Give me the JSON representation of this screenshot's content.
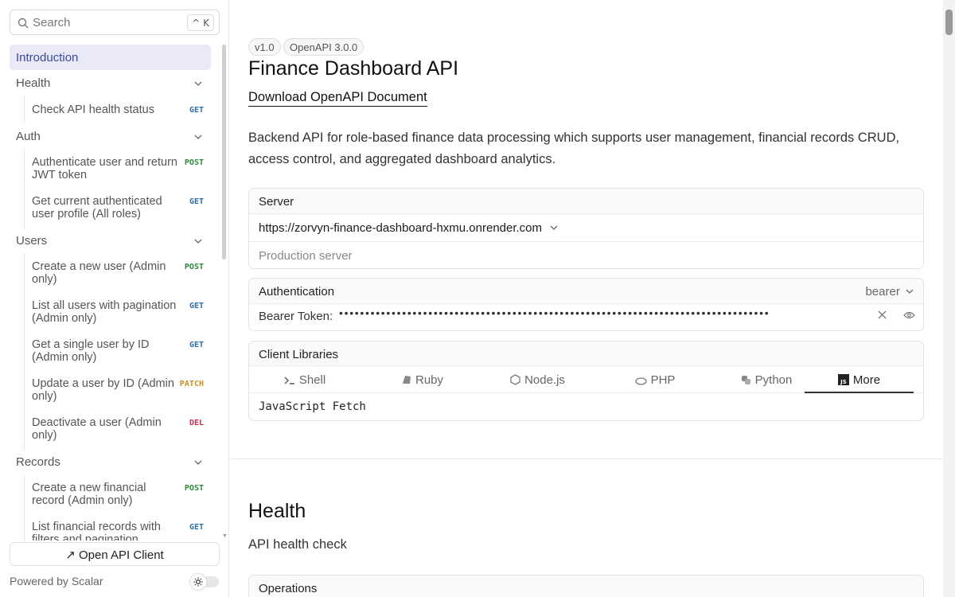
{
  "sidebar": {
    "search_placeholder": "Search",
    "search_shortcut": "^ K",
    "intro": "Introduction",
    "groups": [
      {
        "label": "Health",
        "ops": [
          {
            "name": "Check API health status",
            "method": "GET"
          }
        ]
      },
      {
        "label": "Auth",
        "ops": [
          {
            "name": "Authenticate user and return JWT token",
            "method": "POST"
          },
          {
            "name": "Get current authenticated user profile (All roles)",
            "method": "GET"
          }
        ]
      },
      {
        "label": "Users",
        "ops": [
          {
            "name": "Create a new user (Admin only)",
            "method": "POST"
          },
          {
            "name": "List all users with pagination (Admin only)",
            "method": "GET"
          },
          {
            "name": "Get a single user by ID (Admin only)",
            "method": "GET"
          },
          {
            "name": "Update a user by ID (Admin only)",
            "method": "PATCH"
          },
          {
            "name": "Deactivate a user (Admin only)",
            "method": "DEL"
          }
        ]
      },
      {
        "label": "Records",
        "ops": [
          {
            "name": "Create a new financial record (Admin only)",
            "method": "POST"
          },
          {
            "name": "List financial records with filters and pagination",
            "method": "GET"
          }
        ]
      }
    ],
    "open_client": "Open API Client",
    "powered_by": "Powered by Scalar"
  },
  "colors": {
    "GET": "#2b6ea8",
    "POST": "#2a8a36",
    "PATCH": "#c7901e",
    "DEL": "#c2334b",
    "accent": "#3d4a9e"
  },
  "main": {
    "version_badge": "v1.0",
    "openapi_badge": "OpenAPI 3.0.0",
    "title": "Finance Dashboard API",
    "download_link": "Download OpenAPI Document",
    "description": "Backend API for role-based finance data processing which supports user management, financial records CRUD, access control, and aggregated dashboard analytics.",
    "server": {
      "label": "Server",
      "url": "https://zorvyn-finance-dashboard-hxmu.onrender.com",
      "description": "Production server"
    },
    "auth": {
      "label": "Authentication",
      "scheme": "bearer",
      "token_label": "Bearer Token:",
      "token_mask": "••••••••••••••••••••••••••••••••••••••••••••••••••••••••••••••••••••••••••••••••••"
    },
    "client_libraries": {
      "label": "Client Libraries",
      "tabs": [
        "Shell",
        "Ruby",
        "Node.js",
        "PHP",
        "Python",
        "More"
      ],
      "active_tab": "More",
      "selected_client": "JavaScript Fetch"
    },
    "health": {
      "heading": "Health",
      "description": "API health check",
      "operations_label": "Operations"
    }
  }
}
